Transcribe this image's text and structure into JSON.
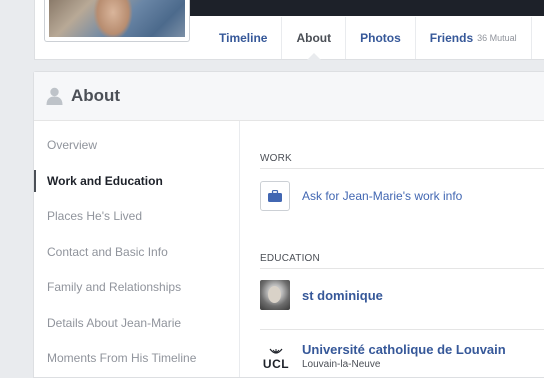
{
  "profile": {
    "tabs": [
      {
        "label": "Timeline"
      },
      {
        "label": "About"
      },
      {
        "label": "Photos"
      },
      {
        "label": "Friends",
        "sub": "36 Mutual"
      }
    ]
  },
  "about": {
    "title": "About",
    "nav": [
      {
        "label": "Overview"
      },
      {
        "label": "Work and Education"
      },
      {
        "label": "Places He's Lived"
      },
      {
        "label": "Contact and Basic Info"
      },
      {
        "label": "Family and Relationships"
      },
      {
        "label": "Details About Jean-Marie"
      },
      {
        "label": "Moments From His Timeline"
      }
    ],
    "active_nav": "Work and Education",
    "work": {
      "heading": "WORK",
      "ask_link": "Ask for Jean-Marie's work info"
    },
    "education": {
      "heading": "EDUCATION",
      "items": [
        {
          "name": "st dominique",
          "icon": "school-photo"
        },
        {
          "name": "Université catholique de Louvain",
          "location": "Louvain-la-Neuve",
          "logo_text": "UCL",
          "icon": "ucl-logo"
        }
      ]
    }
  },
  "colors": {
    "link": "#365899",
    "accent": "#4267b2",
    "page_bg": "#e9ebee"
  }
}
